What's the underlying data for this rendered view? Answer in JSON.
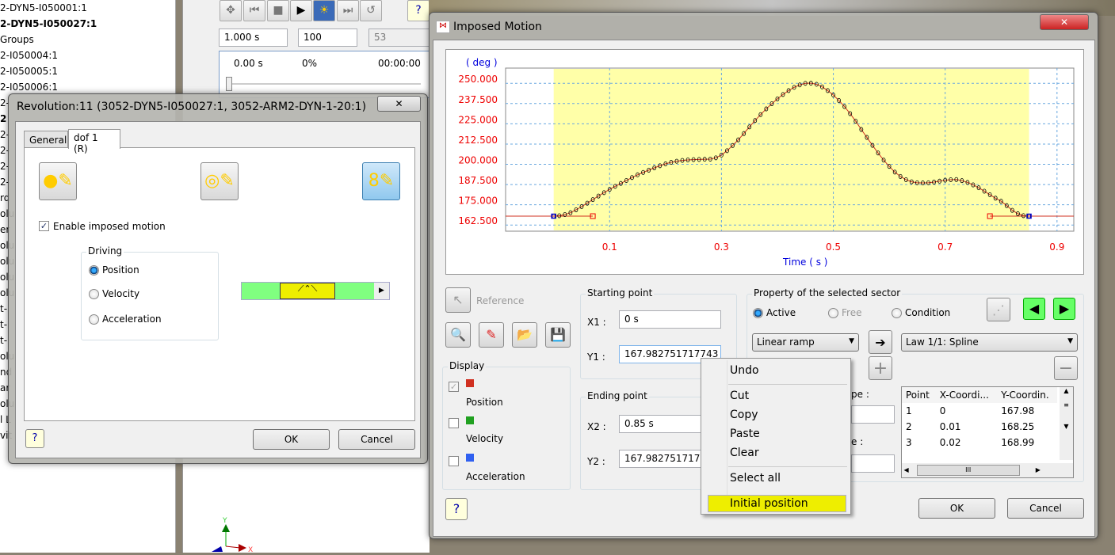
{
  "tree": {
    "items": [
      {
        "label": "2-DYN5-I050001:1",
        "bold": false
      },
      {
        "label": "2-DYN5-I050027:1",
        "bold": true
      },
      {
        "label": "Groups",
        "bold": false
      },
      {
        "label": "2-I050004:1",
        "bold": false
      },
      {
        "label": "2-I050005:1",
        "bold": false
      },
      {
        "label": "2-I050006:1",
        "bold": false
      },
      {
        "label": "2-",
        "bold": false
      },
      {
        "label": "2",
        "bold": true
      },
      {
        "label": "2-",
        "bold": false
      },
      {
        "label": "2-",
        "bold": false
      },
      {
        "label": "2-",
        "bold": false
      },
      {
        "label": "2-",
        "bold": false
      },
      {
        "label": "rd",
        "bold": false
      },
      {
        "label": "olu",
        "bold": false
      },
      {
        "label": "er",
        "bold": false
      },
      {
        "label": "olu",
        "bold": false
      },
      {
        "label": "olu",
        "bold": false
      },
      {
        "label": "olu",
        "bold": false
      },
      {
        "label": "olu",
        "bold": false
      },
      {
        "label": "t-",
        "bold": false
      },
      {
        "label": "t-",
        "bold": false
      },
      {
        "label": "t-",
        "bold": false
      },
      {
        "label": "olu",
        "bold": false
      },
      {
        "label": "nd",
        "bold": false
      },
      {
        "label": "ar",
        "bold": false
      },
      {
        "label": "olu",
        "bold": false
      },
      {
        "label": "l L",
        "bold": false
      },
      {
        "label": "vit",
        "bold": false
      }
    ]
  },
  "simulation": {
    "duration": "1.000 s",
    "steps": "100",
    "frame": "53",
    "time": "0.00 s",
    "percent": "0%",
    "clock": "00:00:00",
    "slider_value": 0
  },
  "revolution_dialog": {
    "title": "Revolution:11 (3052-DYN5-I050027:1, 3052-ARM2-DYN-1-20:1)",
    "tabs": [
      "General",
      "dof 1 (R)"
    ],
    "active_tab": 1,
    "enable_label": "Enable imposed motion",
    "enable_checked": true,
    "driving": {
      "label": "Driving",
      "options": [
        "Position",
        "Velocity",
        "Acceleration"
      ],
      "selected": 0
    },
    "ok": "OK",
    "cancel": "Cancel"
  },
  "imposed_dialog": {
    "title": "Imposed Motion",
    "reference": "Reference",
    "display": {
      "label": "Display",
      "items": [
        {
          "label": "Position",
          "color": "#d03020",
          "checked": true
        },
        {
          "label": "Velocity",
          "color": "#20a020",
          "checked": false
        },
        {
          "label": "Acceleration",
          "color": "#3060f0",
          "checked": false
        }
      ]
    },
    "start": {
      "label": "Starting point",
      "x_label": "X1 :",
      "x": "0 s",
      "y_label": "Y1 :",
      "y": "167.982751717743 d"
    },
    "end": {
      "label": "Ending point",
      "x_label": "X2 :",
      "x": "0.85 s",
      "y_label": "Y2 :",
      "y": "167.98275171774"
    },
    "property": {
      "label": "Property of the selected sector",
      "radios": [
        "Active",
        "Free",
        "Condition"
      ],
      "selected": 0,
      "ramp": "Linear ramp",
      "law": "Law 1/1: Spline",
      "partial_label_1": "pe :",
      "partial_label_2": "e :"
    },
    "table": {
      "headers": [
        "Point",
        "X-Coordi...",
        "Y-Coordin."
      ],
      "rows": [
        [
          "1",
          "0",
          "167.98"
        ],
        [
          "2",
          "0.01",
          "168.25"
        ],
        [
          "3",
          "0.02",
          "168.99"
        ]
      ]
    },
    "ok": "OK",
    "cancel": "Cancel"
  },
  "context_menu": {
    "items": [
      "Undo",
      "Cut",
      "Copy",
      "Paste",
      "Clear",
      "Select all",
      "Initial position"
    ],
    "highlighted": "Initial position"
  },
  "chart_data": {
    "type": "line",
    "ylabel": "( deg )",
    "xlabel": "Time ( s )",
    "xlim": [
      -0.086,
      0.93
    ],
    "ylim": [
      158.7,
      259.4
    ],
    "xticks": [
      "0.1",
      "0.3",
      "0.5",
      "0.7",
      "0.9"
    ],
    "yticks": [
      "250.000",
      "237.500",
      "225.000",
      "212.500",
      "200.000",
      "187.500",
      "175.000",
      "162.500"
    ],
    "grid": true,
    "sector_range": [
      0,
      0.85
    ],
    "sector_color": "#ffffa8",
    "line_color": "#d03020",
    "ramp_handles": [
      0.07,
      0.78
    ],
    "baseline": 167.98,
    "x": [
      0,
      0.01,
      0.02,
      0.03,
      0.04,
      0.05,
      0.06,
      0.07,
      0.08,
      0.09,
      0.1,
      0.11,
      0.12,
      0.13,
      0.14,
      0.15,
      0.16,
      0.17,
      0.18,
      0.19,
      0.2,
      0.21,
      0.22,
      0.23,
      0.24,
      0.25,
      0.26,
      0.27,
      0.28,
      0.29,
      0.3,
      0.31,
      0.32,
      0.33,
      0.34,
      0.35,
      0.36,
      0.37,
      0.38,
      0.39,
      0.4,
      0.41,
      0.42,
      0.43,
      0.44,
      0.45,
      0.46,
      0.47,
      0.48,
      0.49,
      0.5,
      0.51,
      0.52,
      0.53,
      0.54,
      0.55,
      0.56,
      0.57,
      0.58,
      0.59,
      0.6,
      0.61,
      0.62,
      0.63,
      0.64,
      0.65,
      0.66,
      0.67,
      0.68,
      0.69,
      0.7,
      0.71,
      0.72,
      0.73,
      0.74,
      0.75,
      0.76,
      0.77,
      0.78,
      0.79,
      0.8,
      0.81,
      0.82,
      0.83,
      0.84,
      0.85
    ],
    "y": [
      167.98,
      168.25,
      168.99,
      170.1,
      171.9,
      173.9,
      176.0,
      178.2,
      180.4,
      182.5,
      184.5,
      186.4,
      188.2,
      190.0,
      191.8,
      193.5,
      195.0,
      196.4,
      197.8,
      199.1,
      200.3,
      201.2,
      201.9,
      202.4,
      202.7,
      202.9,
      203.0,
      203.1,
      203.2,
      204.0,
      205.7,
      208.4,
      211.6,
      215.1,
      219.0,
      223.1,
      227.0,
      230.7,
      234.2,
      237.4,
      240.4,
      243.1,
      245.5,
      247.5,
      249.0,
      250.0,
      250.1,
      249.4,
      247.8,
      245.5,
      242.8,
      239.4,
      235.6,
      231.3,
      226.6,
      221.5,
      216.6,
      211.7,
      207.0,
      202.6,
      198.7,
      195.2,
      192.5,
      190.5,
      189.2,
      188.6,
      188.5,
      188.6,
      189.0,
      189.6,
      190.2,
      190.5,
      190.6,
      189.9,
      188.8,
      187.3,
      185.5,
      183.4,
      181.2,
      179.1,
      177.2,
      174.5,
      171.6,
      169.5,
      168.3,
      167.98
    ]
  }
}
